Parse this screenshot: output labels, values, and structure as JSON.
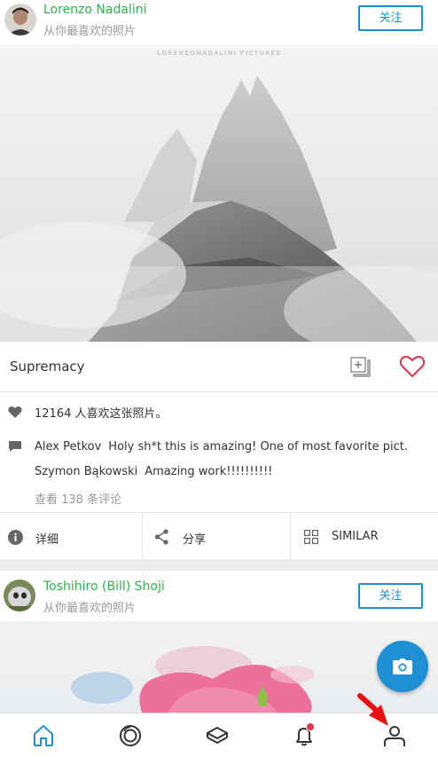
{
  "posts": [
    {
      "author": "Lorenzo Nadalini",
      "subtitle": "从你最喜欢的照片",
      "follow_label": "关注",
      "watermark": "LORENZONADALINI PICTURES",
      "title": "Supremacy",
      "likes_text": "12164 人喜欢这张照片。",
      "comments": [
        {
          "user": "Alex Petkov",
          "text": "Holy sh*t this is amazing! One of most favorite pict."
        },
        {
          "user": "Szymon Bąkowski",
          "text": "Amazing work!!!!!!!!!!"
        }
      ],
      "view_comments": "查看 138 条评论",
      "actions": {
        "details": "详细",
        "share": "分享",
        "similar": "SIMILAR"
      }
    },
    {
      "author": "Toshihiro (Bill) Shoji",
      "subtitle": "从你最喜欢的照片",
      "follow_label": "关注"
    }
  ],
  "nav": [
    "home-icon",
    "discover-icon",
    "feed-icon",
    "notifications-icon",
    "profile-icon"
  ],
  "colors": {
    "accent": "#1f8fd3",
    "author": "#2eb34a",
    "heart": "#e2344a"
  }
}
